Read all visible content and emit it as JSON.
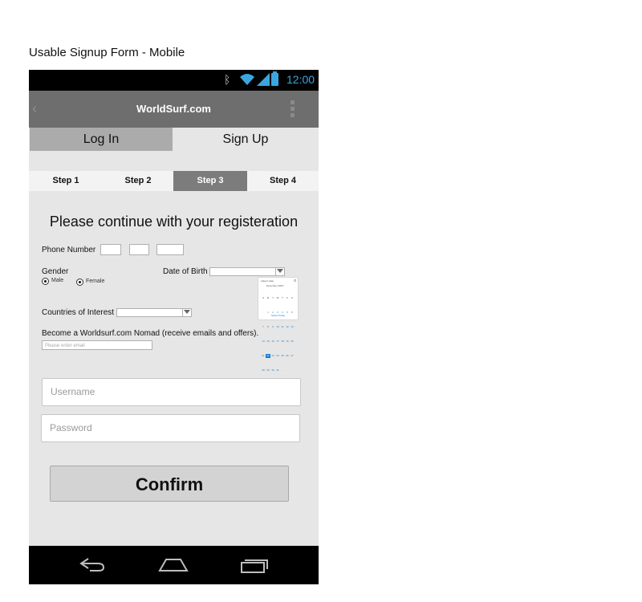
{
  "caption": "Usable Signup Form - Mobile",
  "status_bar": {
    "time": "12:00",
    "icons": [
      "bluetooth-icon",
      "wifi-icon",
      "signal-icon",
      "battery-icon"
    ],
    "accent": "#3aa6e0"
  },
  "action_bar": {
    "title": "WorldSurf.com",
    "back_glyph": "‹",
    "icons": [
      "back-icon",
      "overflow-menu-icon"
    ]
  },
  "tabs": [
    {
      "label": "Log In",
      "active": false
    },
    {
      "label": "Sign Up",
      "active": true
    }
  ],
  "steps": [
    {
      "label": "Step 1",
      "active": false
    },
    {
      "label": "Step 2",
      "active": false
    },
    {
      "label": "Step 3",
      "active": true
    },
    {
      "label": "Step 4",
      "active": false
    }
  ],
  "form": {
    "heading": "Please continue with your registeration",
    "phone_label": "Phone Number",
    "gender_label": "Gender",
    "gender_options": [
      "Male",
      "Female"
    ],
    "dob_label": "Date of Birth",
    "calendar": {
      "title": "today's date",
      "close": "o",
      "month": "December 2010",
      "weekdays": [
        "S",
        "M",
        "T",
        "W",
        "T",
        "F",
        "S"
      ],
      "footer": "Select Today"
    },
    "countries_label": "Countries of Interest",
    "nomad_label": "Become a Worldsurf.com Nomad (receive emails and offers).",
    "email_placeholder": "Please enter email",
    "username_placeholder": "Username",
    "password_placeholder": "Password",
    "confirm_label": "Confirm"
  },
  "nav_bar": {
    "icons": [
      "back-nav-icon",
      "home-nav-icon",
      "recent-apps-icon"
    ]
  }
}
